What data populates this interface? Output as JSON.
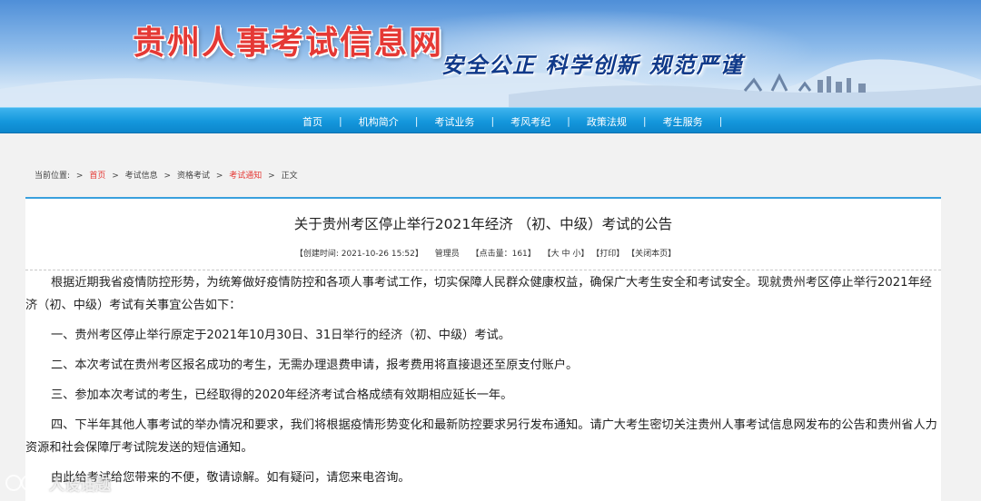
{
  "header": {
    "site_title": "贵州人事考试信息网",
    "slogan": "安全公正  科学创新  规范严谨"
  },
  "nav": {
    "items": [
      "首页",
      "机构简介",
      "考试业务",
      "考风考纪",
      "政策法规",
      "考生服务"
    ],
    "separator": "|"
  },
  "breadcrumb": {
    "label": "当前位置:",
    "arrow": ">",
    "items": [
      "首页",
      "考试信息",
      "资格考试",
      "考试通知",
      "正文"
    ]
  },
  "article": {
    "title": "关于贵州考区停止举行2021年经济 （初、中级）考试的公告",
    "meta": {
      "created": "【创建时间:   2021-10-26 15:52】",
      "author": "管理员",
      "views": "【点击量：161】",
      "font_size": "【大 中 小】",
      "print": "【打印】",
      "close": "【关闭本页】"
    },
    "paragraphs": [
      "根据近期我省疫情防控形势，为统筹做好疫情防控和各项人事考试工作，切实保障人民群众健康权益，确保广大考生安全和考试安全。现就贵州考区停止举行2021年经济（初、中级）考试有关事宜公告如下：",
      "一、贵州考区停止举行原定于2021年10月30日、31日举行的经济（初、中级）考试。",
      "二、本次考试在贵州考区报名成功的考生，无需办理退费申请，报考费用将直接退还至原支付账户。",
      "三、参加本次考试的考生，已经取得的2020年经济考试合格成绩有效期相应延长一年。",
      "四、下半年其他人事考试的举办情况和要求，我们将根据疫情形势变化和最新防控要求另行发布通知。请广大考生密切关注贵州人事考试信息网发布的公告和贵州省人力资源和社会保障厅考试院发送的短信通知。",
      "由此给考试给您带来的不便，敬请谅解。如有疑问，请您来电咨询。"
    ]
  },
  "watermark": {
    "text": "人设话题"
  },
  "colors": {
    "nav_blue": "#1497dc",
    "title_red": "#e53935",
    "slogan_blue": "#103a8a",
    "accent_line": "#3aa0dd"
  }
}
